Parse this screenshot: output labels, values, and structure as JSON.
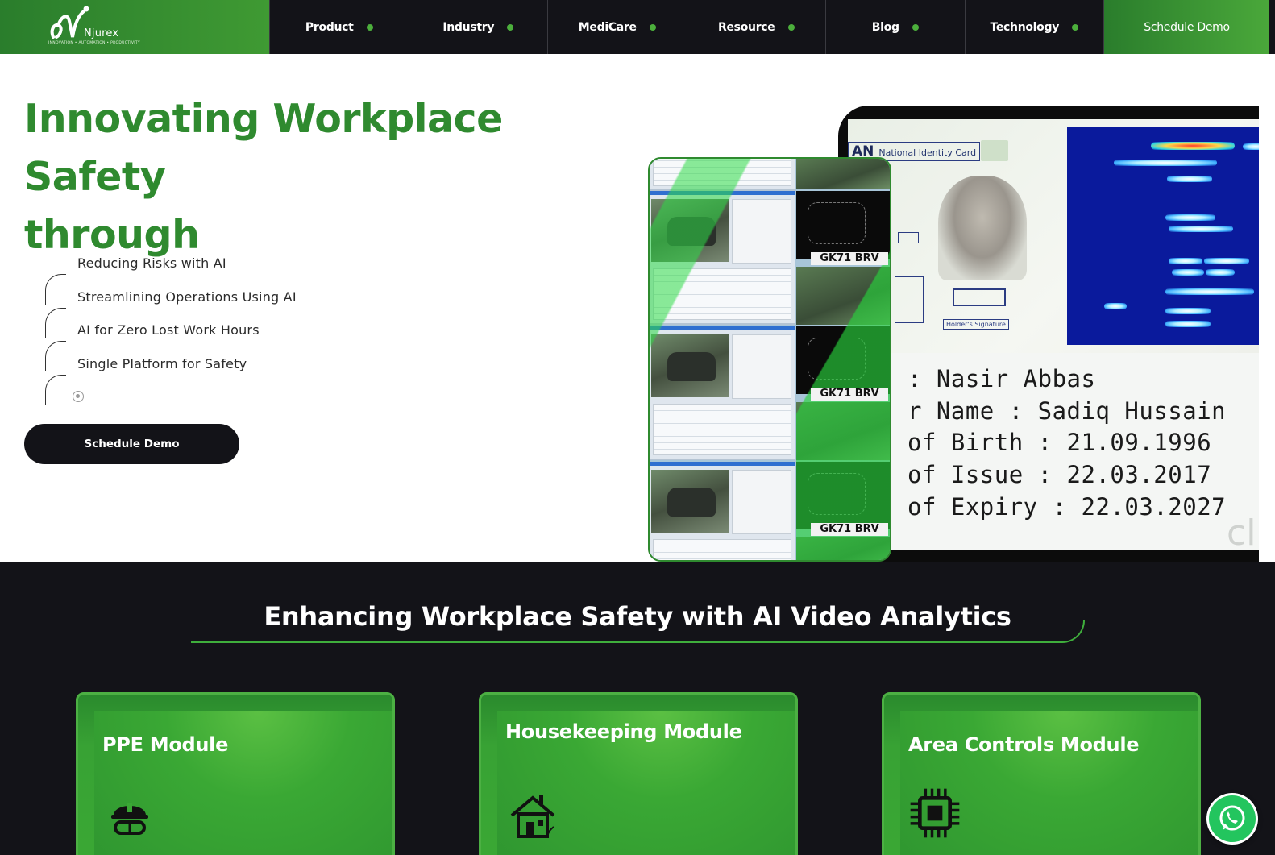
{
  "brand": {
    "logo_text": "Njurex",
    "tagline": "INNOVATION • AUTOMATION • PRODUCTIVITY",
    "accent": "#2f8a2f",
    "dark": "#131318"
  },
  "nav": {
    "items": [
      {
        "label": "Product",
        "icon": "dot-icon"
      },
      {
        "label": "Industry",
        "icon": "dot-icon"
      },
      {
        "label": "MediCare",
        "icon": "dot-icon"
      },
      {
        "label": "Resource",
        "icon": "dot-icon"
      },
      {
        "label": "Blog",
        "icon": "dot-icon"
      },
      {
        "label": "Technology",
        "icon": "dot-icon"
      }
    ],
    "cta_label": "Schedule Demo"
  },
  "hero": {
    "title_line1": "Innovating Workplace Safety",
    "title_line2": "through",
    "features": [
      "Reducing Risks with AI",
      "Streamlining Operations Using AI",
      "AI for Zero Lost Work Hours",
      "Single Platform for Safety"
    ],
    "cta_label": "Schedule Demo"
  },
  "media": {
    "id_card": {
      "header": "AN",
      "header_sub": "National Identity Card",
      "signature_label": "Holder's Signature",
      "lines": [
        ":  Nasir Abbas",
        "r Name :  Sadiq Hussain",
        "of Birth :  21.09.1996",
        "of Issue :  22.03.2017",
        "of Expiry :  22.03.2027"
      ],
      "watermark": "cl"
    },
    "plates": [
      "GK71 BRV",
      "GK71 BRV",
      "GK71 BRV"
    ]
  },
  "section": {
    "title": "Enhancing Workplace Safety with AI Video Analytics",
    "cards": [
      {
        "title": "PPE Module",
        "icon": "helmet-goggles-icon"
      },
      {
        "title": "Housekeeping Module",
        "icon": "house-icon"
      },
      {
        "title": "Area Controls Module",
        "icon": "chip-icon"
      }
    ]
  },
  "whatsapp": {
    "icon": "whatsapp-icon",
    "color": "#23c55e"
  }
}
